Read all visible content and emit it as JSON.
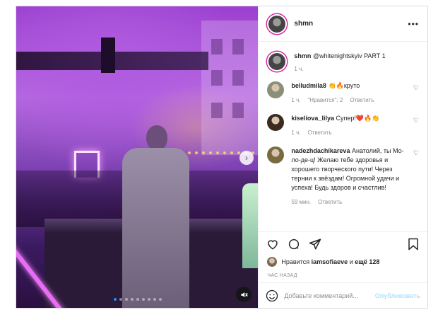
{
  "post": {
    "username": "shmn",
    "caption_mention": "@whitenightskyiv PART 1",
    "caption_time": "1 ч.",
    "carousel": {
      "slide_count": 9,
      "active_index": 0
    }
  },
  "comments": [
    {
      "username": "belludmila8",
      "text": "👏🔥круто",
      "time": "1 ч.",
      "likes": "\"Нравится\": 2",
      "reply": "Ответить",
      "avatar_color": "#8a8f7a"
    },
    {
      "username": "kiseliova_lilya",
      "text": "Супер!❤️🔥👏",
      "time": "1 ч.",
      "likes": "",
      "reply": "Ответить",
      "avatar_color": "#3a2a20"
    },
    {
      "username": "nadezhdachikareva",
      "text": "Анатолий, ты Мо-ло-де-ц! Желаю тебе здоровья и хорошего творческого пути! Через тернии к звёздам! Огромной удачи и успеха! Будь здоров и счастлив!",
      "time": "59 мин.",
      "likes": "",
      "reply": "Ответить",
      "avatar_color": "#7a6a40"
    }
  ],
  "likes": {
    "prefix": "Нравится",
    "user": "iamsofiaeve",
    "suffix": "и",
    "count": "ещё 128"
  },
  "posted_ago": "ЧАС НАЗАД",
  "comment_box": {
    "placeholder": "Добавьте комментарий...",
    "publish_label": "Опубликовать"
  },
  "colors": {
    "accent": "#0095f6",
    "publish_disabled": "#b2dffc",
    "muted": "#8e8e8e"
  },
  "icons": {
    "more": "more-horizontal-icon",
    "heart": "heart-icon",
    "comment": "comment-icon",
    "share": "share-icon",
    "save": "bookmark-icon",
    "emoji": "emoji-icon",
    "mute": "volume-mute-icon",
    "next": "chevron-right-icon"
  }
}
